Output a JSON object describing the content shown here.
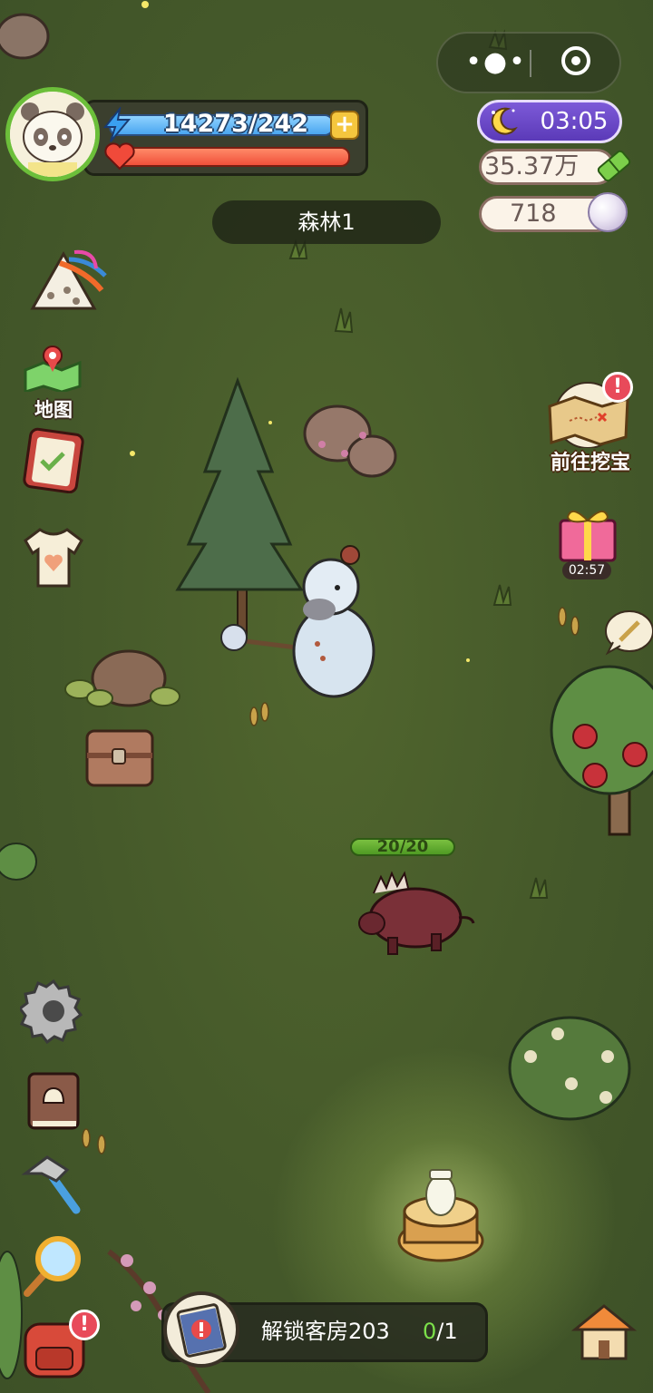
{
  "hud": {
    "energy_text": "14273/242",
    "energy_fraction": 1.0,
    "hp_fraction": 1.0
  },
  "menu_capsule": {
    "more_glyph": "•●•"
  },
  "status": {
    "night_time": "03:05",
    "bamboo_amount": "35.37万",
    "pearl_amount": "718"
  },
  "location": "森林1",
  "left_menu": {
    "map_label": "地图"
  },
  "right_events": {
    "treasure_label": "前往挖宝",
    "treasure_badge": "!",
    "gift_timer": "02:57"
  },
  "boar": {
    "hp_text": "20/20",
    "hp_fraction": 1.0
  },
  "quest": {
    "title": "解锁客房203",
    "progress_done": "0",
    "progress_total": "/1",
    "badge": "!"
  },
  "colors": {
    "ground": "#45592a",
    "energy": "#4aa6f0",
    "hp": "#f0503a",
    "night_pill": "#6b4ac8",
    "quest_progress_done": "#7ce04a",
    "quest_progress_total": "#ffffff",
    "badge": "#e84a5a"
  },
  "icons": {
    "menu_capsule": [
      "more-dots-icon",
      "close-target-icon"
    ],
    "hud": [
      "panda-avatar",
      "lightning-icon",
      "plus-icon",
      "heart-icon"
    ],
    "status": [
      "moon-icon",
      "bamboo-icon",
      "pearl-icon"
    ],
    "left_menu": [
      "zongzi-event-icon",
      "map-icon",
      "notebook-icon",
      "shirt-icon",
      "settings-gear-icon",
      "recipe-book-icon",
      "hammer-icon",
      "magnifier-icon",
      "backpack-icon"
    ],
    "right_events": [
      "treasure-map-icon",
      "gift-box-icon",
      "wheat-bubble-icon",
      "home-icon"
    ]
  }
}
